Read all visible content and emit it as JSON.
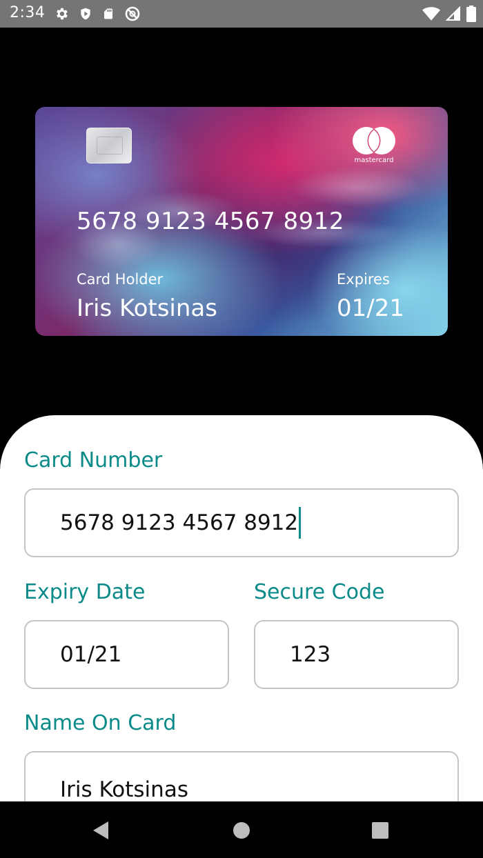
{
  "status_bar": {
    "time": "2:34",
    "left_icons": [
      "gear-icon",
      "shield-icon",
      "sd-card-icon",
      "block-icon"
    ],
    "right_icons": [
      "wifi-icon",
      "signal-icon",
      "battery-icon"
    ]
  },
  "card": {
    "number": "5678 9123 4567 8912",
    "holder_label": "Card Holder",
    "holder_name": "Iris Kotsinas",
    "expires_label": "Expires",
    "expires_value": "01/21",
    "brand": "mastercard"
  },
  "form": {
    "card_number_label": "Card Number",
    "card_number_value": "5678 9123 4567 8912",
    "expiry_label": "Expiry Date",
    "expiry_value": "01/21",
    "secure_code_label": "Secure Code",
    "secure_code_value": "123",
    "name_label": "Name On Card",
    "name_value": "Iris Kotsinas"
  },
  "nav": {
    "icons": [
      "back-icon",
      "home-icon",
      "recents-icon"
    ]
  },
  "colors": {
    "accent": "#0a8a88",
    "status_bar": "#757575",
    "input_border": "#c4c4c4"
  }
}
